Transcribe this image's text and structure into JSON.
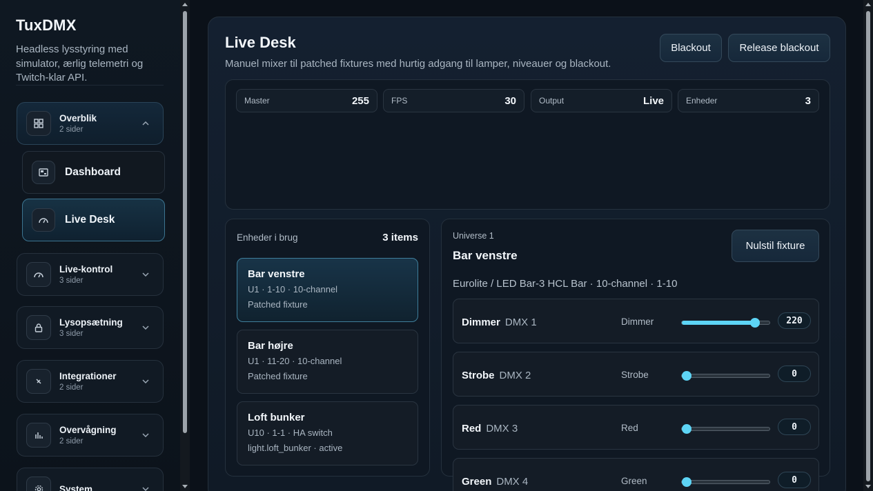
{
  "sidebar": {
    "brand": "TuxDMX",
    "tagline": "Headless lysstyring med simulator, ærlig telemetri og Twitch-klar API.",
    "groups": [
      {
        "title": "Overblik",
        "sub": "2 sider",
        "icon": "grid-icon",
        "open": true
      },
      {
        "title": "Live-kontrol",
        "sub": "3 sider",
        "icon": "gauge-icon"
      },
      {
        "title": "Lysopsætning",
        "sub": "3 sider",
        "icon": "lock-icon"
      },
      {
        "title": "Integrationer",
        "sub": "2 sider",
        "icon": "plug-icon"
      },
      {
        "title": "Overvågning",
        "sub": "2 sider",
        "icon": "bars-icon"
      },
      {
        "title": "System",
        "sub": "",
        "icon": "gear-icon"
      }
    ],
    "subitems": [
      {
        "label": "Dashboard",
        "icon": "dashboard-icon"
      },
      {
        "label": "Live Desk",
        "icon": "gauge-icon",
        "active": true
      }
    ]
  },
  "main": {
    "title": "Live Desk",
    "description": "Manuel mixer til patched fixtures med hurtig adgang til lamper, niveauer og blackout.",
    "buttons": {
      "blackout": "Blackout",
      "release": "Release blackout"
    },
    "stats": [
      {
        "label": "Master",
        "value": "255"
      },
      {
        "label": "FPS",
        "value": "30"
      },
      {
        "label": "Output",
        "value": "Live"
      },
      {
        "label": "Enheder",
        "value": "3"
      }
    ],
    "devices": {
      "heading": "Enheder i brug",
      "count": "3 items",
      "items": [
        {
          "name": "Bar venstre",
          "meta": "U1 · 1-10 · 10-channel",
          "status": "Patched fixture",
          "active": true
        },
        {
          "name": "Bar højre",
          "meta": "U1 · 11-20 · 10-channel",
          "status": "Patched fixture"
        },
        {
          "name": "Loft bunker",
          "meta": "U10 · 1-1 · HA switch",
          "status": "light.loft_bunker · active"
        }
      ]
    },
    "fixture": {
      "universe": "Universe 1",
      "name": "Bar venstre",
      "reset": "Nulstil fixture",
      "description": "Eurolite / LED Bar-3 HCL Bar · 10-channel · 1-10",
      "channels": [
        {
          "name": "Dimmer",
          "dmx": "DMX 1",
          "type": "Dimmer",
          "value": 220
        },
        {
          "name": "Strobe",
          "dmx": "DMX 2",
          "type": "Strobe",
          "value": 0
        },
        {
          "name": "Red",
          "dmx": "DMX 3",
          "type": "Red",
          "value": 0
        },
        {
          "name": "Green",
          "dmx": "DMX 4",
          "type": "Green",
          "value": 0
        }
      ]
    }
  },
  "colors": {
    "accent": "#5dd4f5",
    "background": "#0b1119"
  }
}
